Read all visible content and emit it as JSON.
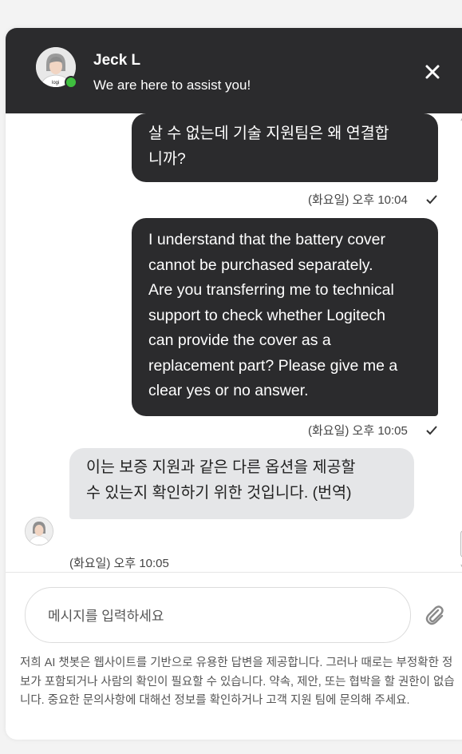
{
  "header": {
    "agent_name": "Jeck L",
    "subtitle": "We are here to assist you!",
    "avatar_label": "logi",
    "status_color": "#3fbf3f",
    "close_icon": "close-icon"
  },
  "messages": [
    {
      "sender": "user",
      "text": "살 수 없는데 기술 지원팀은 왜 연결합\n니까?",
      "time": "(화요일) 오후 10:04",
      "read": true
    },
    {
      "sender": "user",
      "text": "I understand that the battery cover\ncannot be purchased separately.\nAre you transferring me to technical\nsupport to check whether Logitech\ncan provide the cover as a\nreplacement part? Please give me a\nclear yes or no answer.",
      "time": "(화요일) 오후 10:05",
      "read": true
    },
    {
      "sender": "bot",
      "text": "이는 보증 지원과 같은 다른 옵션을 제공할\n수 있는지 확인하기 위한 것입니다. (번역)",
      "time": "(화요일) 오후 10:05"
    }
  ],
  "composer": {
    "placeholder": "메시지를 입력하세요",
    "attach_icon": "paperclip-icon"
  },
  "disclaimer": "저희 AI 챗봇은 웹사이트를 기반으로 유용한 답변을 제공합니다. 그러나 때로는 부정확한 정보가 포함되거나 사람의 확인이 필요할 수 있습니다. 약속, 제안, 또는 협박을 할 권한이 없습니다. 중요한 문의사항에 대해선 정보를 확인하거나 고객 지원 팀에 문의해 주세요.",
  "colors": {
    "header_bg": "#2b2b2d",
    "user_bubble": "#2b2b2d",
    "bot_bubble": "#e5e6e8"
  }
}
